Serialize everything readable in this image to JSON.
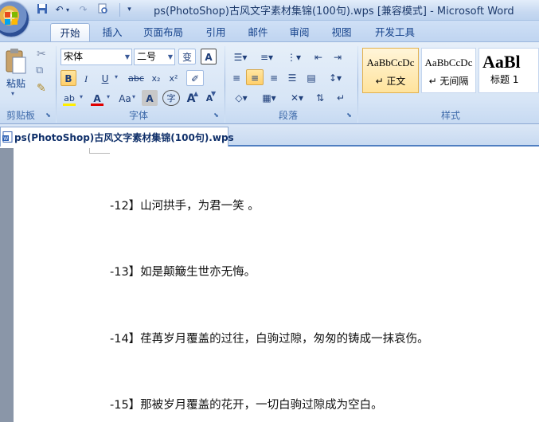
{
  "title": "ps(PhotoShop)古风文字素材集锦(100句).wps [兼容模式] - Microsoft Word",
  "quick_access": [
    "save-icon",
    "undo-icon",
    "redo-icon",
    "print-preview-icon",
    "customize-icon"
  ],
  "tabs": [
    "开始",
    "插入",
    "页面布局",
    "引用",
    "邮件",
    "审阅",
    "视图",
    "开发工具"
  ],
  "clipboard": {
    "paste_label": "粘贴",
    "group_label": "剪贴板"
  },
  "font": {
    "name": "宋体",
    "size": "二号",
    "wen": "变",
    "group_label": "字体",
    "bold": "B",
    "italic": "I",
    "underline": "U",
    "strike": "abc",
    "sub": "x₂",
    "sup": "x²",
    "highlight": "ab",
    "font_color": "A",
    "change_case": "Aa",
    "char_shade": "A",
    "enclose": "字",
    "grow": "A",
    "shrink": "A",
    "char_border": "A"
  },
  "paragraph": {
    "group_label": "段落"
  },
  "styles": {
    "group_label": "样式",
    "items": [
      {
        "sample": "AaBbCcDc",
        "name": "↵ 正文"
      },
      {
        "sample": "AaBbCcDc",
        "name": "↵ 无间隔"
      },
      {
        "sample": "AaBl",
        "name": "标题 1"
      }
    ]
  },
  "doc_tab": "ps(PhotoShop)古风文字素材集锦(100句).wps",
  "lines": [
    "-12】山河拱手，为君一笑 。",
    "-13】如是颠簸生世亦无悔。",
    "-14】荏苒岁月覆盖的过往，白驹过隙，匆匆的铸成一抹哀伤。",
    "-15】那被岁月覆盖的花开，一切白驹过隙成为空白。"
  ]
}
